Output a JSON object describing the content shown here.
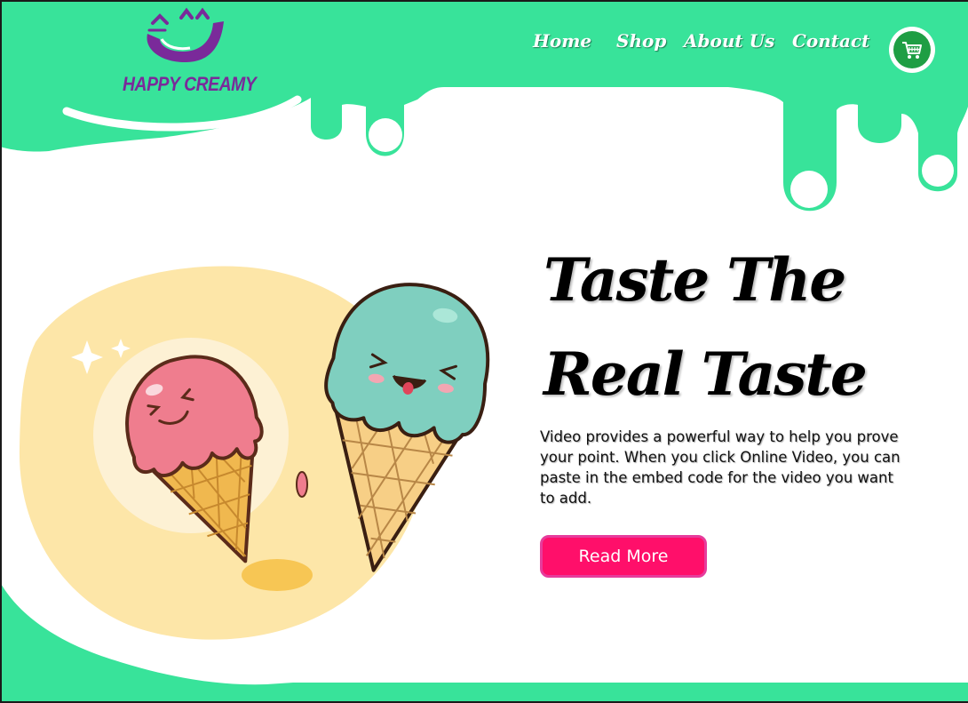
{
  "brand": {
    "name": "HAPPY CREAMY",
    "logo_icon": "happy-face-logo-icon",
    "color": "#7a2a9a"
  },
  "nav": {
    "items": [
      {
        "label": "Home"
      },
      {
        "label": "Shop"
      },
      {
        "label": "About Us"
      },
      {
        "label": "Contact"
      }
    ],
    "cart_icon": "shopping-cart-icon"
  },
  "hero": {
    "headline_line1": "Taste The",
    "headline_line2": "Real Taste",
    "description": "Video provides a powerful way to help you prove your point. When you click Online Video, you can paste in the embed code for the video you want to add.",
    "button_label": "Read More",
    "illustration": "ice-cream-cones-illustration"
  },
  "colors": {
    "mint": "#38e39a",
    "accent_pink": "#ff0f6a",
    "cart_green": "#1f9e44",
    "cone": "#f0b84f",
    "pink_scoop": "#ef7d8e",
    "teal_scoop": "#7fcfbf",
    "halo": "#fde6a8"
  }
}
